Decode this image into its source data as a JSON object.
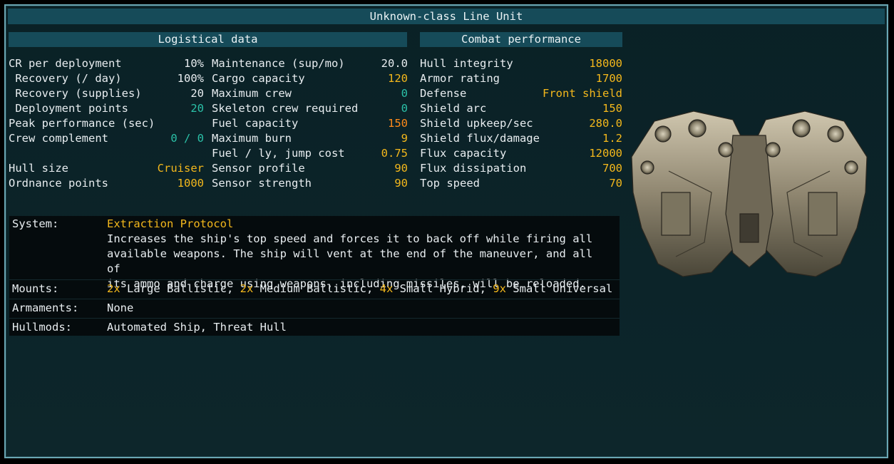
{
  "title": "Unknown-class Line Unit",
  "logistical": {
    "header": "Logistical data",
    "left": [
      {
        "label": "CR per deployment",
        "value": "10%",
        "color": "white"
      },
      {
        "label": " Recovery (/ day)",
        "value": "100%",
        "color": "white"
      },
      {
        "label": " Recovery (supplies)",
        "value": "20",
        "color": "white"
      },
      {
        "label": " Deployment points",
        "value": "20",
        "color": "teal"
      },
      {
        "label": "Peak performance (sec)",
        "value": "",
        "color": "white"
      },
      {
        "label": "Crew complement",
        "value": "0 / 0",
        "color": "teal"
      },
      {
        "label": "",
        "value": "",
        "color": "white"
      },
      {
        "label": "Hull size",
        "value": "Cruiser",
        "color": "yellow"
      },
      {
        "label": "Ordnance points",
        "value": "1000",
        "color": "yellow"
      }
    ],
    "right": [
      {
        "label": "Maintenance (sup/mo)",
        "value": "20.0",
        "color": "white"
      },
      {
        "label": "Cargo capacity",
        "value": "120",
        "color": "yellow"
      },
      {
        "label": "Maximum crew",
        "value": "0",
        "color": "teal"
      },
      {
        "label": "Skeleton crew required",
        "value": "0",
        "color": "teal"
      },
      {
        "label": "Fuel capacity",
        "value": "150",
        "color": "orange"
      },
      {
        "label": "Maximum burn",
        "value": "9",
        "color": "yellow"
      },
      {
        "label": "Fuel / ly, jump cost",
        "value": "0.75",
        "color": "yellow"
      },
      {
        "label": "Sensor profile",
        "value": "90",
        "color": "yellow"
      },
      {
        "label": "Sensor strength",
        "value": "90",
        "color": "yellow"
      }
    ]
  },
  "combat": {
    "header": "Combat performance",
    "rows": [
      {
        "label": "Hull integrity",
        "value": "18000",
        "color": "yellow"
      },
      {
        "label": "Armor rating",
        "value": "1700",
        "color": "yellow"
      },
      {
        "label": "Defense",
        "value": "Front shield",
        "color": "yellow"
      },
      {
        "label": "Shield arc",
        "value": "150",
        "color": "yellow"
      },
      {
        "label": "Shield upkeep/sec",
        "value": "280.0",
        "color": "yellow"
      },
      {
        "label": "Shield flux/damage",
        "value": "1.2",
        "color": "yellow"
      },
      {
        "label": "Flux capacity",
        "value": "12000",
        "color": "yellow"
      },
      {
        "label": "Flux dissipation",
        "value": "700",
        "color": "yellow"
      },
      {
        "label": "Top speed",
        "value": "70",
        "color": "yellow"
      }
    ]
  },
  "info": {
    "system_label": "System:",
    "system_name": "Extraction Protocol",
    "system_desc": [
      "Increases the ship's top speed and forces it to back off while firing all",
      "available weapons. The ship will vent at the end of the maneuver, and all of",
      "its ammo and charge using weapons, including missiles, will be reloaded."
    ],
    "mounts_label": "Mounts:",
    "mounts": [
      {
        "count": "2x",
        "name": " Large Ballistic, "
      },
      {
        "count": "2x",
        "name": " Medium Ballistic, "
      },
      {
        "count": "4x",
        "name": " Small Hybrid, "
      },
      {
        "count": "9x",
        "name": " Small Universal"
      }
    ],
    "armaments_label": "Armaments:",
    "armaments": "None",
    "hullmods_label": "Hullmods:",
    "hullmods": "Automated Ship, Threat Hull"
  },
  "colors": {
    "white": "#e8edf0",
    "yellow": "#f4b81c",
    "teal": "#2bc1a8",
    "orange": "#ff8a1a"
  }
}
